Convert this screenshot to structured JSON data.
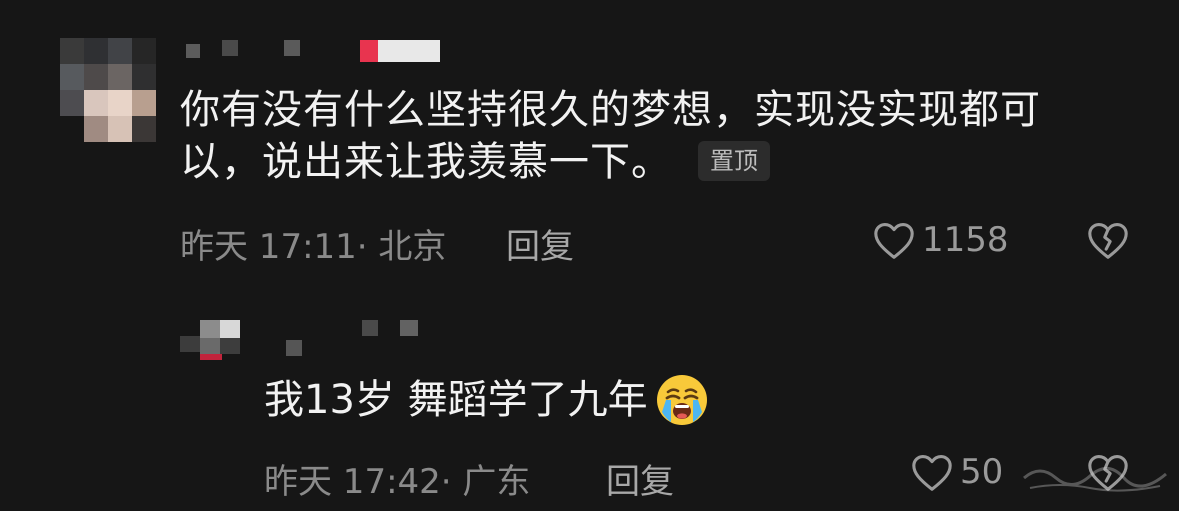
{
  "main_comment": {
    "text": "你有没有什么坚持很久的梦想，实现没实现都可以，说出来让我羡慕一下。",
    "pinned_label": "置顶",
    "meta": "昨天 17:11· 北京",
    "reply_label": "回复",
    "like_count": "1158"
  },
  "reply_comment": {
    "text": "我13岁 舞蹈学了九年",
    "meta": "昨天 17:42· 广东",
    "reply_label": "回复",
    "like_count": "50"
  },
  "icons": {
    "like": "heart-outline-icon",
    "dislike": "broken-heart-icon",
    "emoji": "loudly-crying-face-emoji"
  },
  "colors": {
    "background": "#161616",
    "text_primary": "#f2f2f2",
    "text_secondary": "#8a8a8a",
    "badge_bg": "#2c2c2c"
  }
}
